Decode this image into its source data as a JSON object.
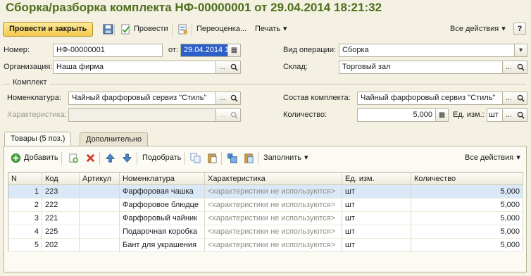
{
  "title": "Сборка/разборка комплекта НФ-00000001 от 29.04.2014 18:21:32",
  "toolbar": {
    "post_close": "Провести и закрыть",
    "post": "Провести",
    "revaluation": "Переоценка...",
    "print": "Печать",
    "all_actions": "Все действия",
    "help": "?"
  },
  "header": {
    "number_label": "Номер:",
    "number_value": "НФ-00000001",
    "date_label": "от:",
    "date_value": "29.04.2014 1",
    "operation_label": "Вид операции:",
    "operation_value": "Сборка",
    "org_label": "Организация:",
    "org_value": "Наша фирма",
    "warehouse_label": "Склад:",
    "warehouse_value": "Торговый зал"
  },
  "kit": {
    "group_title": "Комплект",
    "nomenclature_label": "Номенклатура:",
    "nomenclature_value": "Чайный фарфоровый сервиз \"Стиль\"",
    "characteristic_label": "Характеристика:",
    "characteristic_value": "",
    "composition_label": "Состав комплекта:",
    "composition_value": "Чайный фарфоровый сервиз \"Стиль\"",
    "quantity_label": "Количество:",
    "quantity_value": "5,000",
    "unit_label": "Ед. изм.:",
    "unit_value": "шт"
  },
  "tabs": [
    {
      "label": "Товары (5 поз.)",
      "active": true
    },
    {
      "label": "Дополнительно",
      "active": false
    }
  ],
  "grid_toolbar": {
    "add": "Добавить",
    "pick": "Подобрать",
    "fill": "Заполнить",
    "all_actions": "Все действия"
  },
  "table": {
    "columns": [
      "N",
      "Код",
      "Артикул",
      "Номенклатура",
      "Характеристика",
      "Ед. изм.",
      "Количество"
    ],
    "rows": [
      {
        "n": "1",
        "code": "223",
        "article": "",
        "name": "Фарфоровая чашка",
        "char": "<характеристики не используются>",
        "unit": "шт",
        "qty": "5,000"
      },
      {
        "n": "2",
        "code": "222",
        "article": "",
        "name": "Фарфоровое блюдце",
        "char": "<характеристики не используются>",
        "unit": "шт",
        "qty": "5,000"
      },
      {
        "n": "3",
        "code": "221",
        "article": "",
        "name": "Фарфоровый чайник",
        "char": "<характеристики не используются>",
        "unit": "шт",
        "qty": "5,000"
      },
      {
        "n": "4",
        "code": "225",
        "article": "",
        "name": "Подарочная коробка",
        "char": "<характеристики не используются>",
        "unit": "шт",
        "qty": "5,000"
      },
      {
        "n": "5",
        "code": "202",
        "article": "",
        "name": "Бант для украшения",
        "char": "<характеристики не используются>",
        "unit": "шт",
        "qty": "5,000"
      }
    ]
  },
  "icons": {
    "ellipsis": "...",
    "search": "🔍",
    "calendar": "▦",
    "dropdown": "▾"
  },
  "colors": {
    "title": "#4d6f1c",
    "selection": "#2c5fc8",
    "selected_row": "#dbe8f8",
    "primary_button": "#f3c94c"
  }
}
